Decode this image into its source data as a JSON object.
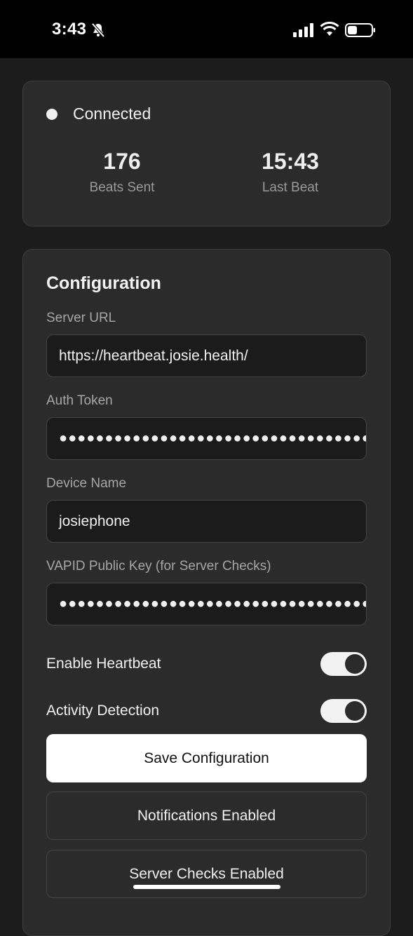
{
  "statusbar": {
    "time": "3:43",
    "icons": [
      "bell-slash-icon",
      "cellular-signal-icon",
      "wifi-icon",
      "battery-icon"
    ]
  },
  "status": {
    "state": "Connected",
    "beats_sent_value": "176",
    "beats_sent_label": "Beats Sent",
    "last_beat_value": "15:43",
    "last_beat_label": "Last Beat"
  },
  "config": {
    "title": "Configuration",
    "server_url_label": "Server URL",
    "server_url_value": "https://heartbeat.josie.health/",
    "auth_token_label": "Auth Token",
    "auth_token_value": "●●●●●●●●●●●●●●●●●●●●●●●●●●●●●●●●●●●",
    "device_name_label": "Device Name",
    "device_name_value": "josiephone",
    "vapid_label": "VAPID Public Key (for Server Checks)",
    "vapid_value": "●●●●●●●●●●●●●●●●●●●●●●●●●●●●●●●●●●●",
    "enable_heartbeat_label": "Enable Heartbeat",
    "enable_heartbeat_on": true,
    "activity_detection_label": "Activity Detection",
    "activity_detection_on": true,
    "save_label": "Save Configuration",
    "notifications_label": "Notifications Enabled",
    "server_checks_label": "Server Checks Enabled"
  },
  "colors": {
    "background": "#1c1c1c",
    "card": "#2b2b2b",
    "input": "#1b1b1b",
    "primary_button": "#ffffff",
    "toggle_on": "#f2f2f2"
  }
}
